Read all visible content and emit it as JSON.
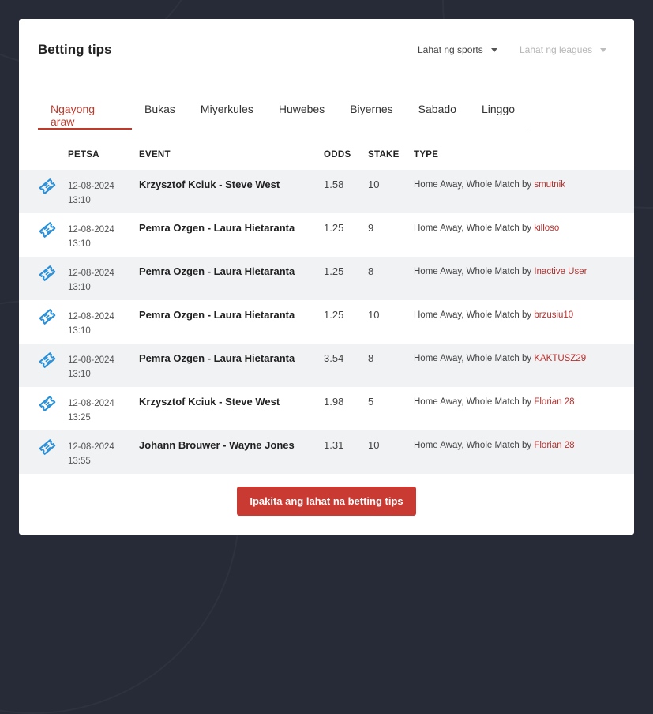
{
  "header": {
    "title": "Betting tips",
    "sports_filter": "Lahat ng sports",
    "leagues_filter": "Lahat ng leagues"
  },
  "tabs": [
    {
      "label": "Ngayong araw",
      "active": true
    },
    {
      "label": "Bukas"
    },
    {
      "label": "Miyerkules"
    },
    {
      "label": "Huwebes"
    },
    {
      "label": "Biyernes"
    },
    {
      "label": "Sabado"
    },
    {
      "label": "Linggo"
    }
  ],
  "columns": {
    "date": "PETSA",
    "event": "EVENT",
    "odds": "ODDS",
    "stake": "STAKE",
    "type": "TYPE"
  },
  "tips": [
    {
      "date": "12-08-2024",
      "time": "13:10",
      "event": "Krzysztof Kciuk - Steve West",
      "odds": "1.58",
      "stake": "10",
      "type": "Home Away, Whole Match by",
      "user": "smutnik"
    },
    {
      "date": "12-08-2024",
      "time": "13:10",
      "event": "Pemra Ozgen - Laura Hietaranta",
      "odds": "1.25",
      "stake": "9",
      "type": "Home Away, Whole Match by",
      "user": "killoso"
    },
    {
      "date": "12-08-2024",
      "time": "13:10",
      "event": "Pemra Ozgen - Laura Hietaranta",
      "odds": "1.25",
      "stake": "8",
      "type": "Home Away, Whole Match by",
      "user": "Inactive User"
    },
    {
      "date": "12-08-2024",
      "time": "13:10",
      "event": "Pemra Ozgen - Laura Hietaranta",
      "odds": "1.25",
      "stake": "10",
      "type": "Home Away, Whole Match by",
      "user": "brzusiu10"
    },
    {
      "date": "12-08-2024",
      "time": "13:10",
      "event": "Pemra Ozgen - Laura Hietaranta",
      "odds": "3.54",
      "stake": "8",
      "type": "Home Away, Whole Match by",
      "user": "KAKTUSZ29"
    },
    {
      "date": "12-08-2024",
      "time": "13:25",
      "event": "Krzysztof Kciuk - Steve West",
      "odds": "1.98",
      "stake": "5",
      "type": "Home Away, Whole Match by",
      "user": "Florian 28"
    },
    {
      "date": "12-08-2024",
      "time": "13:55",
      "event": "Johann Brouwer - Wayne Jones",
      "odds": "1.31",
      "stake": "10",
      "type": "Home Away, Whole Match by",
      "user": "Florian 28"
    }
  ],
  "cta_label": "Ipakita ang lahat na betting tips",
  "icons": {
    "row_icon": "ticket-icon",
    "dropdown": "chevron-down-icon"
  },
  "colors": {
    "accent": "#c0392b",
    "background": "#262b37",
    "row_alt": "#f1f2f4"
  }
}
